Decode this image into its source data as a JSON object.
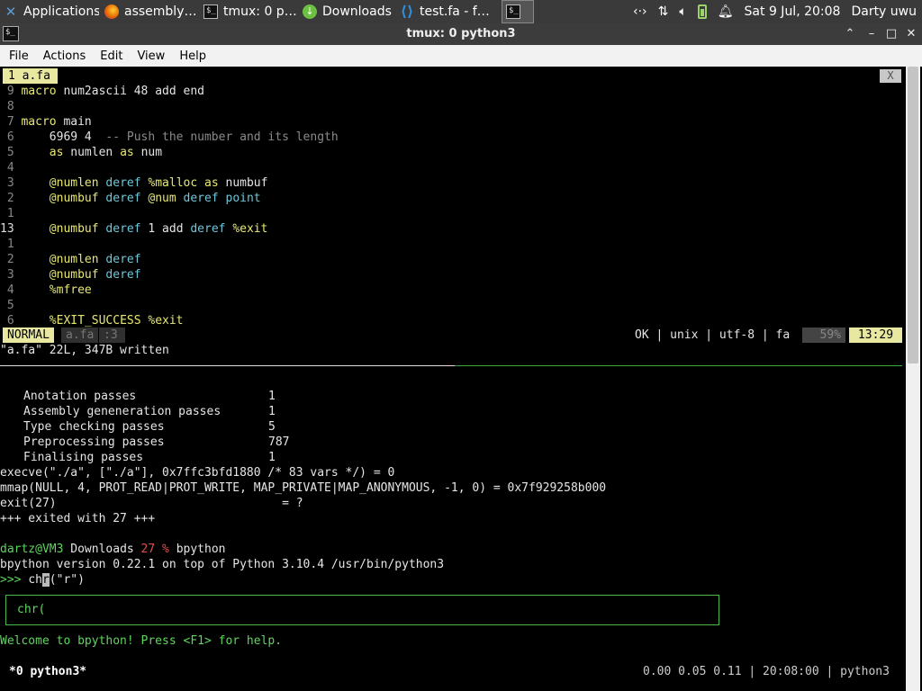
{
  "panel": {
    "tasks": [
      {
        "label": "Applications ☰",
        "icon": "xfce-logo"
      },
      {
        "label": "assembly…",
        "icon": "firefox"
      },
      {
        "label": "tmux: 0 p…",
        "icon": "terminal"
      },
      {
        "label": "Downloads",
        "icon": "download"
      },
      {
        "label": "test.fa - f…",
        "icon": "vscode"
      },
      {
        "label": "",
        "icon": "terminal"
      }
    ],
    "clock": "Sat  9 Jul, 20:08",
    "user": "Darty uwu"
  },
  "window": {
    "title": "tmux: 0 python3"
  },
  "menubar": [
    "File",
    "Actions",
    "Edit",
    "View",
    "Help"
  ],
  "editor": {
    "tab_label": "1 a.fa",
    "close_label": "X",
    "lines": [
      {
        "n": " 9",
        "code": [
          {
            "t": "macro ",
            "c": "c-yellow"
          },
          {
            "t": "num2ascii 48 add end",
            "c": ""
          }
        ]
      },
      {
        "n": " 8",
        "code": []
      },
      {
        "n": " 7",
        "code": [
          {
            "t": "macro ",
            "c": "c-yellow"
          },
          {
            "t": "main",
            "c": ""
          }
        ]
      },
      {
        "n": " 6",
        "code": [
          {
            "t": "    6969 4  ",
            "c": ""
          },
          {
            "t": "-- Push the number and its length",
            "c": "c-gray"
          }
        ]
      },
      {
        "n": " 5",
        "code": [
          {
            "t": "    ",
            "c": ""
          },
          {
            "t": "as ",
            "c": "c-yellow"
          },
          {
            "t": "numlen ",
            "c": ""
          },
          {
            "t": "as ",
            "c": "c-yellow"
          },
          {
            "t": "num",
            "c": ""
          }
        ]
      },
      {
        "n": " 4",
        "code": []
      },
      {
        "n": " 3",
        "code": [
          {
            "t": "    ",
            "c": ""
          },
          {
            "t": "@numlen ",
            "c": "c-yellow"
          },
          {
            "t": "deref ",
            "c": "c-cyan"
          },
          {
            "t": "%malloc ",
            "c": "c-yellow"
          },
          {
            "t": "as ",
            "c": "c-yellow"
          },
          {
            "t": "numbuf",
            "c": ""
          }
        ]
      },
      {
        "n": " 2",
        "code": [
          {
            "t": "    ",
            "c": ""
          },
          {
            "t": "@numbuf ",
            "c": "c-yellow"
          },
          {
            "t": "deref ",
            "c": "c-cyan"
          },
          {
            "t": "@num ",
            "c": "c-yellow"
          },
          {
            "t": "deref ",
            "c": "c-cyan"
          },
          {
            "t": "point",
            "c": "c-cyan"
          }
        ]
      },
      {
        "n": " 1",
        "code": []
      },
      {
        "n": "13",
        "cur": true,
        "code": [
          {
            "t": "    ",
            "c": ""
          },
          {
            "t": "@numbuf ",
            "c": "c-yellow"
          },
          {
            "t": "deref ",
            "c": "c-cyan"
          },
          {
            "t": "1 add ",
            "c": ""
          },
          {
            "t": "deref ",
            "c": "c-cyan"
          },
          {
            "t": "%exit",
            "c": "c-yellow"
          }
        ]
      },
      {
        "n": " 1",
        "code": []
      },
      {
        "n": " 2",
        "code": [
          {
            "t": "    ",
            "c": ""
          },
          {
            "t": "@numlen ",
            "c": "c-yellow"
          },
          {
            "t": "deref",
            "c": "c-cyan"
          }
        ]
      },
      {
        "n": " 3",
        "code": [
          {
            "t": "    ",
            "c": ""
          },
          {
            "t": "@numbuf ",
            "c": "c-yellow"
          },
          {
            "t": "deref",
            "c": "c-cyan"
          }
        ]
      },
      {
        "n": " 4",
        "code": [
          {
            "t": "    ",
            "c": ""
          },
          {
            "t": "%mfree",
            "c": "c-yellow"
          }
        ]
      },
      {
        "n": " 5",
        "code": []
      },
      {
        "n": " 6",
        "code": [
          {
            "t": "    ",
            "c": ""
          },
          {
            "t": "%EXIT_SUCCESS %exit",
            "c": "c-yellow"
          }
        ]
      }
    ],
    "status": {
      "mode": "NORMAL",
      "file": "a.fa",
      "col": ":3",
      "info": "OK | unix | utf-8 | fa",
      "percent": "59%",
      "pos": "13:29"
    },
    "message": "\"a.fa\" 22L, 347B written"
  },
  "shell": {
    "passes": [
      {
        "name": "Anotation passes",
        "count": "1"
      },
      {
        "name": "Assembly geneneration passes",
        "count": "1"
      },
      {
        "name": "Type checking passes",
        "count": "5"
      },
      {
        "name": "Preprocessing passes",
        "count": "787"
      },
      {
        "name": "Finalising passes",
        "count": "1"
      }
    ],
    "strace": [
      "execve(\"./a\", [\"./a\"], 0x7ffc3bfd1880 /* 83 vars */) = 0",
      "mmap(NULL, 4, PROT_READ|PROT_WRITE, MAP_PRIVATE|MAP_ANONYMOUS, -1, 0) = 0x7f929258b000",
      "exit(27)                                = ?",
      "+++ exited with 27 +++"
    ],
    "prompt": {
      "user": "dartz@VM3",
      "dir": " Downloads ",
      "code": "27",
      "sym": " % ",
      "cmd": "bpython"
    },
    "version": "bpython version 0.22.1 on top of Python 3.10.4 /usr/bin/python3",
    "repl": {
      "ps1": ">>> ",
      "before": "ch",
      "cursor": "r",
      "after": "(\"r\")"
    },
    "suggestion": "chr(",
    "welcome": "Welcome to bpython! Press <F1> for help."
  },
  "tmux": {
    "window": "*0 python3*",
    "right": "0.00 0.05 0.11 | 20:08:00 | python3"
  }
}
